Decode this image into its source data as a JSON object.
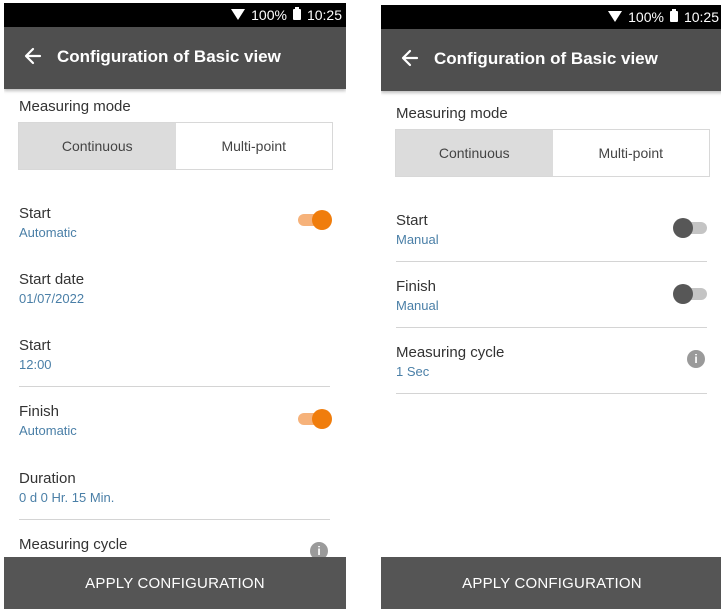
{
  "status_bar": {
    "battery": "100%",
    "time": "10:25"
  },
  "left": {
    "title": "Configuration of Basic view",
    "measuring_mode_label": "Measuring mode",
    "mode_options": [
      "Continuous",
      "Multi-point"
    ],
    "selected_mode": "Continuous",
    "rows": [
      {
        "label": "Start",
        "value": "Automatic",
        "toggle": true
      },
      {
        "label": "Start date",
        "value": "01/07/2022"
      },
      {
        "label": "Start",
        "value": "12:00"
      },
      {
        "label": "Finish",
        "value": "Automatic",
        "toggle": true
      },
      {
        "label": "Duration",
        "value": "0 d 0 Hr. 15 Min."
      },
      {
        "label": "Measuring cycle"
      }
    ],
    "apply_label": "APPLY CONFIGURATION"
  },
  "right": {
    "title": "Configuration of Basic view",
    "measuring_mode_label": "Measuring mode",
    "mode_options": [
      "Continuous",
      "Multi-point"
    ],
    "selected_mode": "Continuous",
    "rows": [
      {
        "label": "Start",
        "value": "Manual",
        "toggle": false
      },
      {
        "label": "Finish",
        "value": "Manual",
        "toggle": false
      },
      {
        "label": "Measuring cycle",
        "value": "1 Sec"
      }
    ],
    "apply_label": "APPLY CONFIGURATION"
  },
  "colors": {
    "accent_orange": "#f07d0c",
    "value_blue": "#4a7fa7",
    "appbar_gray": "#4f4f4f"
  },
  "icons": [
    "wifi-icon",
    "battery-icon",
    "back-arrow-icon",
    "info-icon"
  ]
}
